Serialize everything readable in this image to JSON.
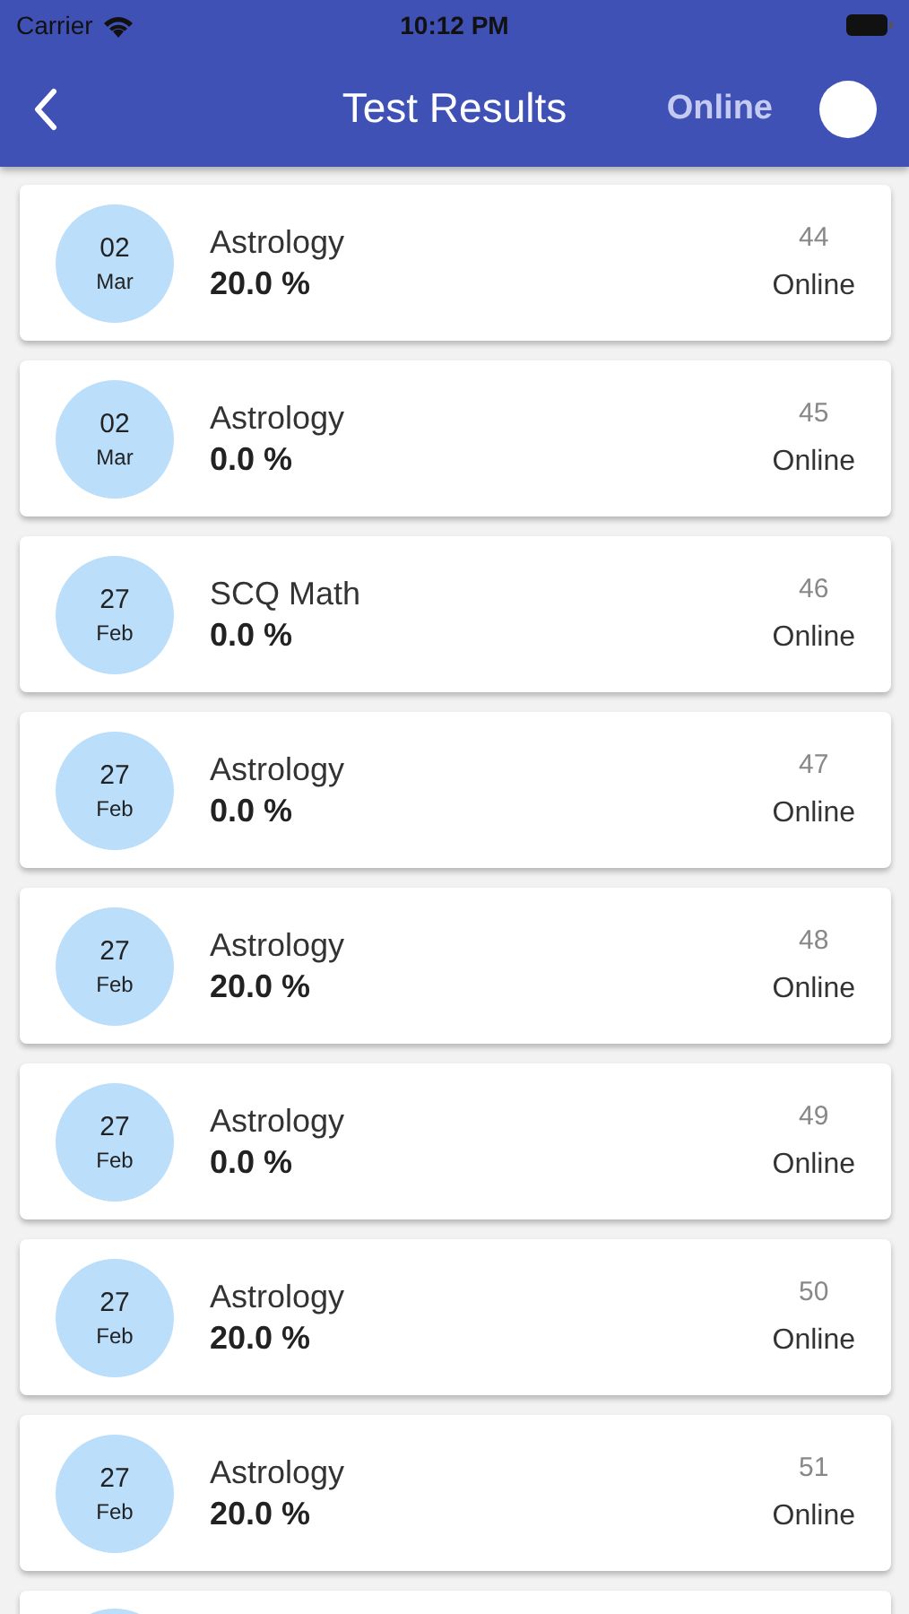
{
  "status_bar": {
    "carrier": "Carrier",
    "time": "10:12 PM"
  },
  "app_bar": {
    "title": "Test Results",
    "mode_label": "Online",
    "mode_switch": {
      "on": true
    }
  },
  "results": [
    {
      "day": "02",
      "month": "Mar",
      "subject": "Astrology",
      "score": "20.0 %",
      "number": "44",
      "mode": "Online"
    },
    {
      "day": "02",
      "month": "Mar",
      "subject": "Astrology",
      "score": "0.0 %",
      "number": "45",
      "mode": "Online"
    },
    {
      "day": "27",
      "month": "Feb",
      "subject": "SCQ Math",
      "score": "0.0 %",
      "number": "46",
      "mode": "Online"
    },
    {
      "day": "27",
      "month": "Feb",
      "subject": "Astrology",
      "score": "0.0 %",
      "number": "47",
      "mode": "Online"
    },
    {
      "day": "27",
      "month": "Feb",
      "subject": "Astrology",
      "score": "20.0 %",
      "number": "48",
      "mode": "Online"
    },
    {
      "day": "27",
      "month": "Feb",
      "subject": "Astrology",
      "score": "0.0 %",
      "number": "49",
      "mode": "Online"
    },
    {
      "day": "27",
      "month": "Feb",
      "subject": "Astrology",
      "score": "20.0 %",
      "number": "50",
      "mode": "Online"
    },
    {
      "day": "27",
      "month": "Feb",
      "subject": "Astrology",
      "score": "20.0 %",
      "number": "51",
      "mode": "Online"
    }
  ]
}
